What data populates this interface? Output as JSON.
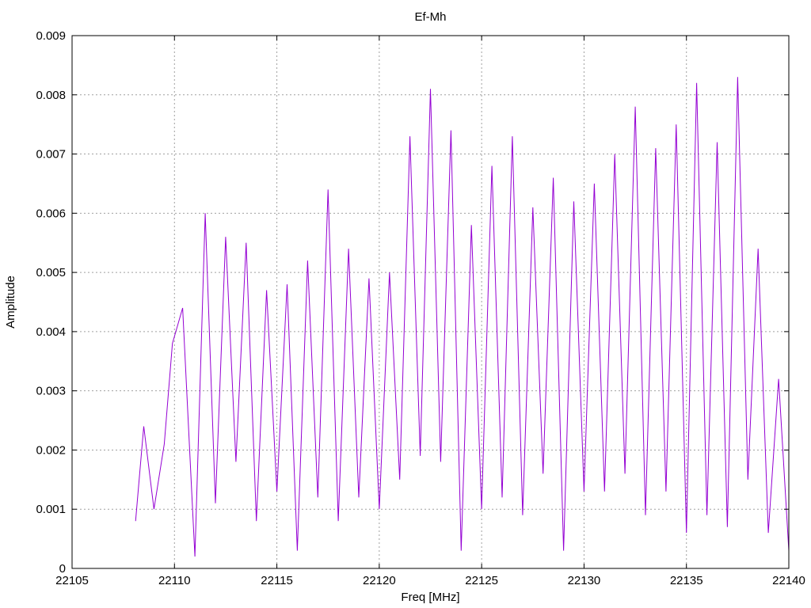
{
  "chart_data": {
    "type": "line",
    "title": "Ef-Mh",
    "xlabel": "Freq [MHz]",
    "ylabel": "Amplitude",
    "xlim": [
      22105,
      22140
    ],
    "ylim": [
      0,
      0.009
    ],
    "xticks": [
      22105,
      22110,
      22115,
      22120,
      22125,
      22130,
      22135,
      22140
    ],
    "xtick_labels": [
      "22105",
      "22110",
      "22115",
      "22120",
      "22125",
      "22130",
      "22135",
      "22140"
    ],
    "yticks": [
      0,
      0.001,
      0.002,
      0.003,
      0.004,
      0.005,
      0.006,
      0.007,
      0.008,
      0.009
    ],
    "ytick_labels": [
      "0",
      "0.001",
      "0.002",
      "0.003",
      "0.004",
      "0.005",
      "0.006",
      "0.007",
      "0.008",
      "0.009"
    ],
    "grid": true,
    "line_color": "#9400d3",
    "x": [
      22108.1,
      22108.5,
      22109.0,
      22109.5,
      22109.9,
      22110.4,
      22111.0,
      22111.5,
      22112.0,
      22112.5,
      22113.0,
      22113.5,
      22114.0,
      22114.5,
      22115.0,
      22115.5,
      22116.0,
      22116.5,
      22117.0,
      22117.5,
      22118.0,
      22118.5,
      22119.0,
      22119.5,
      22120.0,
      22120.5,
      22121.0,
      22121.5,
      22122.0,
      22122.5,
      22123.0,
      22123.5,
      22124.0,
      22124.5,
      22125.0,
      22125.5,
      22126.0,
      22126.5,
      22127.0,
      22127.5,
      22128.0,
      22128.5,
      22129.0,
      22129.5,
      22130.0,
      22130.5,
      22131.0,
      22131.5,
      22132.0,
      22132.5,
      22133.0,
      22133.5,
      22134.0,
      22134.5,
      22135.0,
      22135.5,
      22136.0,
      22136.5,
      22137.0,
      22137.5,
      22138.0,
      22138.5,
      22139.0,
      22139.5,
      22140.0
    ],
    "y": [
      0.0008,
      0.0024,
      0.001,
      0.0021,
      0.0038,
      0.0044,
      0.0002,
      0.006,
      0.0011,
      0.0056,
      0.0018,
      0.0055,
      0.0008,
      0.0047,
      0.0013,
      0.0048,
      0.0003,
      0.0052,
      0.0012,
      0.0064,
      0.0008,
      0.0054,
      0.0012,
      0.0049,
      0.001,
      0.005,
      0.0015,
      0.0073,
      0.0019,
      0.0081,
      0.0018,
      0.0074,
      0.0003,
      0.0058,
      0.001,
      0.0068,
      0.0012,
      0.0073,
      0.0009,
      0.0061,
      0.0016,
      0.0066,
      0.0003,
      0.0062,
      0.0013,
      0.0065,
      0.0013,
      0.007,
      0.0016,
      0.0078,
      0.0009,
      0.0071,
      0.0013,
      0.0075,
      0.0006,
      0.0082,
      0.0009,
      0.0072,
      0.0007,
      0.0083,
      0.0015,
      0.0054,
      0.0006,
      0.0032,
      0.0003
    ]
  }
}
